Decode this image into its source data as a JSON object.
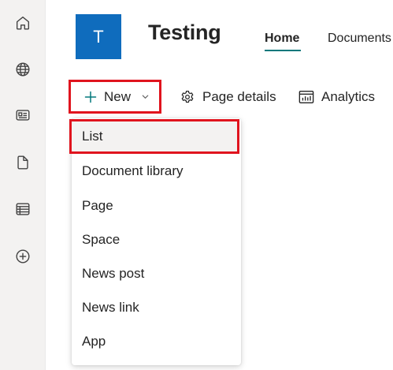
{
  "rail": {
    "items": [
      {
        "icon": "home-icon"
      },
      {
        "icon": "globe-icon"
      },
      {
        "icon": "news-icon"
      },
      {
        "icon": "file-icon"
      },
      {
        "icon": "list-icon"
      },
      {
        "icon": "add-circle-icon"
      }
    ]
  },
  "site": {
    "logo_letter": "T",
    "title": "Testing",
    "logo_color": "#0f6cbd",
    "nav": [
      {
        "label": "Home",
        "active": true
      },
      {
        "label": "Documents",
        "active": false
      }
    ]
  },
  "toolbar": {
    "new_label": "New",
    "page_details_label": "Page details",
    "analytics_label": "Analytics"
  },
  "menu": {
    "items": [
      {
        "label": "List",
        "highlighted": true
      },
      {
        "label": "Document library"
      },
      {
        "label": "Page"
      },
      {
        "label": "Space"
      },
      {
        "label": "News post"
      },
      {
        "label": "News link"
      },
      {
        "label": "App"
      }
    ]
  },
  "colors": {
    "accent": "#03787c",
    "highlight_border": "#e0141e"
  }
}
